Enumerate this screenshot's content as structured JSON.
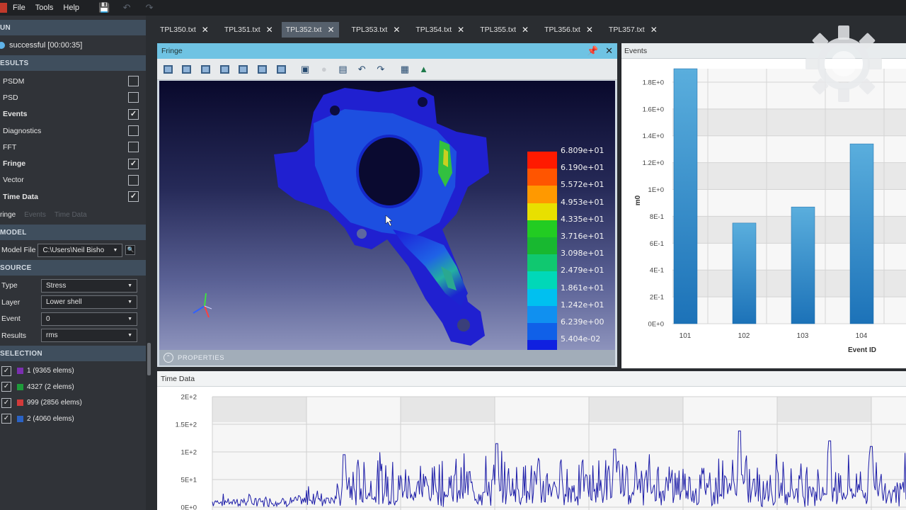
{
  "menubar": {
    "items": [
      "File",
      "Tools",
      "Help"
    ],
    "icons": [
      "save-icon",
      "undo-icon",
      "redo-icon"
    ]
  },
  "left": {
    "run": {
      "header": "UN",
      "status": "successful [00:00:35]"
    },
    "results": {
      "header": "ESULTS",
      "items": [
        {
          "label": "PSDM",
          "checked": false,
          "bold": false
        },
        {
          "label": "PSD",
          "checked": false,
          "bold": false
        },
        {
          "label": "Events",
          "checked": true,
          "bold": true
        },
        {
          "label": "Diagnostics",
          "checked": false,
          "bold": false
        },
        {
          "label": "FFT",
          "checked": false,
          "bold": false
        },
        {
          "label": "Fringe",
          "checked": true,
          "bold": true
        },
        {
          "label": "Vector",
          "checked": false,
          "bold": false
        },
        {
          "label": "Time Data",
          "checked": true,
          "bold": true
        }
      ]
    },
    "subtabs": [
      "ringe",
      "Events",
      "Time Data"
    ],
    "model": {
      "header": "MODEL",
      "label": "Model File",
      "value": "C:\\Users\\Neil Bisho"
    },
    "source": {
      "header": "SOURCE",
      "fields": [
        {
          "label": "Type",
          "value": "Stress"
        },
        {
          "label": "Layer",
          "value": "Lower shell"
        },
        {
          "label": "Event",
          "value": "0"
        },
        {
          "label": "Results",
          "value": "rms"
        }
      ]
    },
    "selection": {
      "header": "SELECTION",
      "items": [
        {
          "label": "1 (9365 elems)",
          "color": "#7b2fb0"
        },
        {
          "label": "4327 (2 elems)",
          "color": "#1e9b3a"
        },
        {
          "label": "999 (2856 elems)",
          "color": "#d23a3a"
        },
        {
          "label": "2 (4060 elems)",
          "color": "#2a62c4"
        }
      ]
    }
  },
  "tabs": [
    "TPL350.txt",
    "TPL351.txt",
    "TPL352.txt",
    "TPL353.txt",
    "TPL354.txt",
    "TPL355.txt",
    "TPL356.txt",
    "TPL357.txt"
  ],
  "active_tab": 2,
  "fringe": {
    "title": "Fringe",
    "properties_label": "PROPERTIES",
    "toolbar_icons": [
      "view-iso-icon",
      "view-front-icon",
      "view-back-icon",
      "view-left-icon",
      "view-right-icon",
      "view-top-icon",
      "view-bottom-icon",
      "fit-view-icon",
      "light-icon",
      "zoom-box-icon",
      "undo-icon",
      "redo-icon",
      "grid-icon",
      "probe-icon"
    ],
    "legend": {
      "labels": [
        "6.809e+01",
        "6.190e+01",
        "5.572e+01",
        "4.953e+01",
        "4.335e+01",
        "3.716e+01",
        "3.098e+01",
        "2.479e+01",
        "1.861e+01",
        "1.242e+01",
        "6.239e+00",
        "5.404e-02"
      ],
      "colors": [
        "#ff1a00",
        "#ff5500",
        "#ff9900",
        "#e8e000",
        "#22cc22",
        "#18b830",
        "#10c870",
        "#00d8b8",
        "#00c0f0",
        "#1090f0",
        "#1060e8",
        "#1020e0"
      ]
    }
  },
  "events": {
    "title": "Events",
    "chart_data": {
      "type": "bar",
      "categories": [
        "101",
        "102",
        "103",
        "104"
      ],
      "values": [
        1.9,
        0.75,
        0.87,
        1.34
      ],
      "ylabel": "m0",
      "xlabel": "Event ID",
      "ylim": [
        0,
        1.9
      ],
      "yticks": [
        0,
        0.2,
        0.4,
        0.6,
        0.8,
        1.0,
        1.2,
        1.4,
        1.6,
        1.8
      ],
      "ytick_labels": [
        "0E+0",
        "2E-1",
        "4E-1",
        "6E-1",
        "8E-1",
        "1E+0",
        "1.2E+0",
        "1.4E+0",
        "1.6E+0",
        "1.8E+0"
      ],
      "grid": true,
      "color": "#2a86c4"
    }
  },
  "timedata": {
    "title": "Time Data",
    "chart_data": {
      "type": "line",
      "ylim": [
        0,
        200
      ],
      "yticks": [
        0,
        50,
        100,
        150,
        200
      ],
      "ytick_labels": [
        "0E+0",
        "5E+1",
        "1E+2",
        "1.5E+2",
        "2E+2"
      ],
      "grid": true,
      "color": "#1c1ca8",
      "segments": [
        {
          "from": 0.0,
          "to": 0.135,
          "baseline": 12,
          "spread": 14
        },
        {
          "from": 0.135,
          "to": 0.19,
          "baseline": 18,
          "spread": 30
        },
        {
          "from": 0.19,
          "to": 1.0,
          "baseline": 30,
          "spread": 75
        }
      ],
      "peaks": [
        {
          "x": 0.19,
          "y": 95
        },
        {
          "x": 0.41,
          "y": 115
        },
        {
          "x": 0.58,
          "y": 105
        },
        {
          "x": 0.76,
          "y": 138
        },
        {
          "x": 0.89,
          "y": 120
        },
        {
          "x": 0.95,
          "y": 110
        }
      ]
    }
  },
  "watermark": "gear-logo-icon"
}
